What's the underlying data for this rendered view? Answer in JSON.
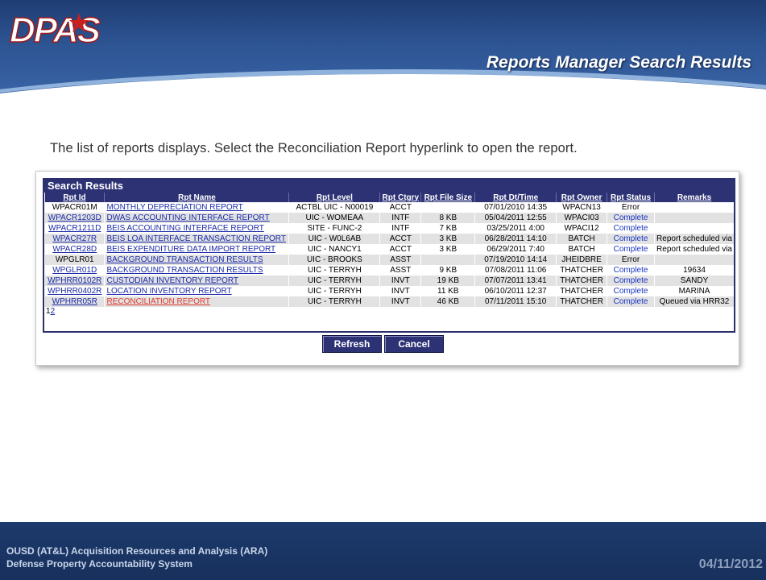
{
  "header": {
    "logo_text": "DPAS",
    "slide_title": "Reports Manager Search Results"
  },
  "instruction": "The list of reports displays. Select the Reconciliation Report  hyperlink to open the report.",
  "results": {
    "title": "Search Results",
    "columns": [
      "Rpt Id",
      "Rpt Name",
      "Rpt Level",
      "Rpt Ctgry",
      "Rpt File Size",
      "Rpt Dt/Time",
      "Rpt Owner",
      "Rpt Status",
      "Remarks"
    ],
    "rows": [
      {
        "id": "WPACR01M",
        "name": "MONTHLY DEPRECIATION REPORT",
        "level": "ACTBL UIC - N00019",
        "ctgry": "ACCT",
        "size": "",
        "dt": "07/01/2010 14:35",
        "owner": "WPACN13",
        "status": "Error",
        "remarks": ""
      },
      {
        "id": "WPACR1203D",
        "name": "DWAS ACCOUNTING INTERFACE REPORT",
        "level": "UIC - WOMEAA",
        "ctgry": "INTF",
        "size": "8 KB",
        "dt": "05/04/2011 12:55",
        "owner": "WPACI03",
        "status": "Complete",
        "remarks": ""
      },
      {
        "id": "WPACR1211D",
        "name": "BEIS ACCOUNTING INTERFACE REPORT",
        "level": "SITE - FUNC-2",
        "ctgry": "INTF",
        "size": "7 KB",
        "dt": "03/25/2011 4:00",
        "owner": "WPACI12",
        "status": "Complete",
        "remarks": ""
      },
      {
        "id": "WPACR27R",
        "name": "BEIS LOA INTERFACE TRANSACTION REPORT",
        "level": "UIC - W0L6AB",
        "ctgry": "ACCT",
        "size": "3 KB",
        "dt": "06/28/2011 14:10",
        "owner": "BATCH",
        "status": "Complete",
        "remarks": "Report scheduled via"
      },
      {
        "id": "WPACR28D",
        "name": "BEIS EXPENDITURE DATA IMPORT REPORT",
        "level": "UIC - NANCY1",
        "ctgry": "ACCT",
        "size": "3 KB",
        "dt": "06/29/2011 7:40",
        "owner": "BATCH",
        "status": "Complete",
        "remarks": "Report scheduled via"
      },
      {
        "id": "WPGLR01",
        "name": "BACKGROUND TRANSACTION RESULTS",
        "level": "UIC - BROOKS",
        "ctgry": "ASST",
        "size": "",
        "dt": "07/19/2010 14:14",
        "owner": "JHEIDBRE",
        "status": "Error",
        "remarks": ""
      },
      {
        "id": "WPGLR01D",
        "name": "BACKGROUND TRANSACTION RESULTS",
        "level": "UIC - TERRYH",
        "ctgry": "ASST",
        "size": "9 KB",
        "dt": "07/08/2011 11:06",
        "owner": "THATCHER",
        "status": "Complete",
        "remarks": "19634"
      },
      {
        "id": "WPHRR0102R",
        "name": "CUSTODIAN INVENTORY REPORT",
        "level": "UIC - TERRYH",
        "ctgry": "INVT",
        "size": "19 KB",
        "dt": "07/07/2011 13:41",
        "owner": "THATCHER",
        "status": "Complete",
        "remarks": "SANDY"
      },
      {
        "id": "WPHRR0402R",
        "name": "LOCATION INVENTORY REPORT",
        "level": "UIC - TERRYH",
        "ctgry": "INVT",
        "size": "11 KB",
        "dt": "06/10/2011 12:37",
        "owner": "THATCHER",
        "status": "Complete",
        "remarks": "MARINA"
      },
      {
        "id": "WPHRR05R",
        "name": "RECONCILIATION REPORT",
        "level": "UIC - TERRYH",
        "ctgry": "INVT",
        "size": "46 KB",
        "dt": "07/11/2011 15:10",
        "owner": "THATCHER",
        "status": "Complete",
        "remarks": "Queued via HRR32"
      }
    ],
    "pager": {
      "current": "1",
      "next": "2"
    }
  },
  "buttons": {
    "refresh": "Refresh",
    "cancel": "Cancel"
  },
  "footer": {
    "line1": "OUSD (AT&L) Acquisition Resources and Analysis (ARA)",
    "line2": "Defense Property Accountability System",
    "date": "04/11/2012"
  },
  "colors": {
    "header_blue": "#2e5594",
    "grid_header": "#2d3275",
    "link": "#1a2aa8",
    "highlight_link": "#e03a2d"
  }
}
